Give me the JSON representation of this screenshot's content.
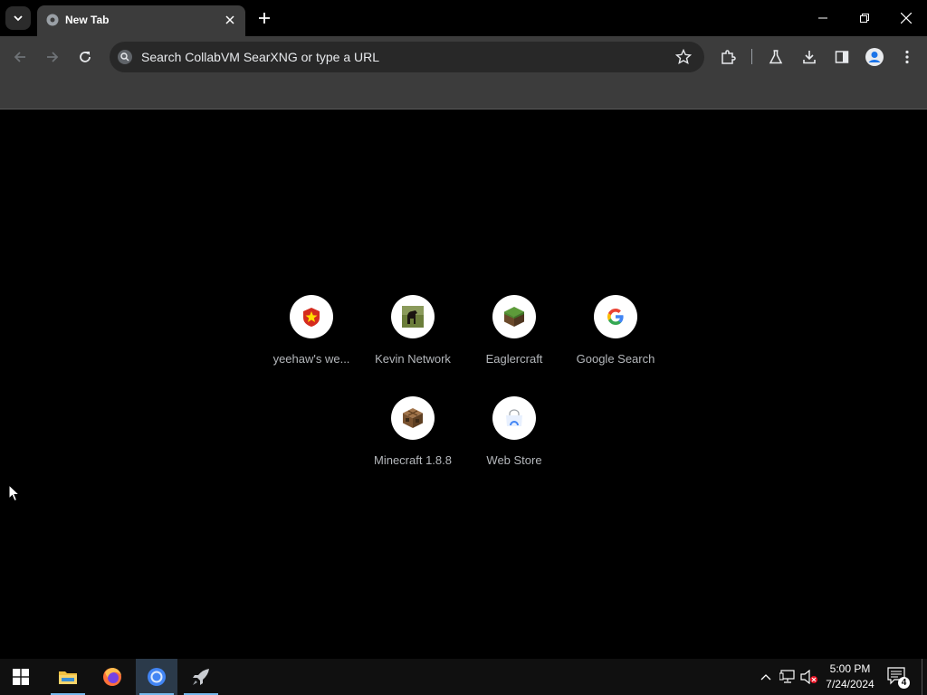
{
  "tab": {
    "title": "New Tab"
  },
  "omnibox": {
    "placeholder": "Search CollabVM SearXNG or type a URL"
  },
  "shortcuts": [
    {
      "label": "yeehaw's we...",
      "icon": "red-star-badge-icon"
    },
    {
      "label": "Kevin Network",
      "icon": "horse-image-icon"
    },
    {
      "label": "Eaglercraft",
      "icon": "grass-block-icon"
    },
    {
      "label": "Google Search",
      "icon": "google-g-icon"
    },
    {
      "label": "Minecraft 1.8.8",
      "icon": "crafting-table-icon"
    },
    {
      "label": "Web Store",
      "icon": "web-store-icon"
    }
  ],
  "taskbar": {
    "time": "5:00 PM",
    "date": "7/24/2024",
    "notification_count": "4"
  },
  "colors": {
    "accent": "#76b9ed",
    "toolbar": "#3c3c3c",
    "background": "#000000"
  }
}
